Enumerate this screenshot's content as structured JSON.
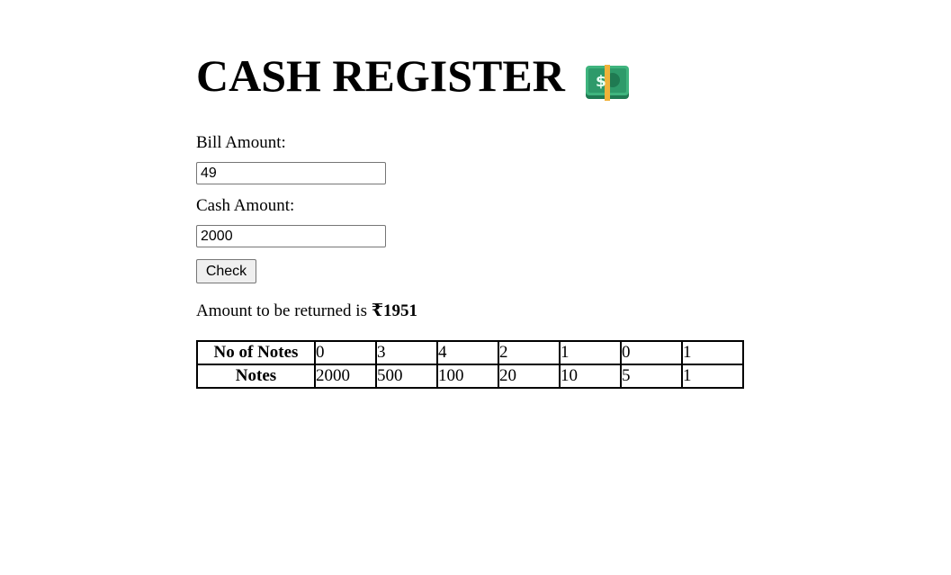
{
  "header": {
    "title": "CASH REGISTER",
    "icon": "money-with-wings-icon"
  },
  "form": {
    "bill_label": "Bill Amount:",
    "bill_value": "49",
    "cash_label": "Cash Amount:",
    "cash_value": "2000",
    "check_label": "Check"
  },
  "result": {
    "prefix": "Amount to be returned is ",
    "amount": "₹1951"
  },
  "table": {
    "row_headers": [
      "No of Notes",
      "Notes"
    ],
    "counts": [
      "0",
      "3",
      "4",
      "2",
      "1",
      "0",
      "1"
    ],
    "denominations": [
      "2000",
      "500",
      "100",
      "20",
      "10",
      "5",
      "1"
    ]
  },
  "colors": {
    "note_green": "#2e9a6a",
    "note_band": "#f0b23a"
  }
}
